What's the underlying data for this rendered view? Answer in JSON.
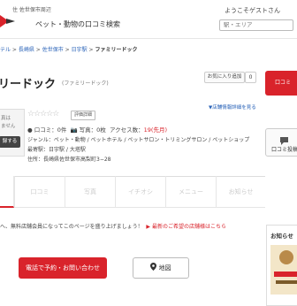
{
  "header": {
    "region": "住 佐世保市周辺",
    "site_name": "ペット・動物の口コミ検索",
    "welcome": "ようこそゲストさん",
    "search_placeholder": "駅・エリア"
  },
  "breadcrumb": {
    "items": [
      "テル",
      "長崎県",
      "佐世保市",
      "日宇駅"
    ],
    "separator": " > ",
    "current": "ファミリードック"
  },
  "store": {
    "title": "リードック",
    "reading": "(ファミリードック)",
    "favorite_label": "お気に入り追加",
    "favorite_count": "0",
    "info_link": "▼店舗情報詳細を見る",
    "photo_text": "真は\nません",
    "register_label": "録する",
    "stars": "☆☆☆☆☆",
    "rating_label": "評価詳細",
    "stats": {
      "reviews": "● 口コミ：0件",
      "photos": "📷 写真：0枚",
      "access_prefix": "アクセス数：",
      "access_value": "19(先月)"
    },
    "genre": "ジャンル：ペット・動物 / ペットホテル / ペットサロン・トリミングサロン / ペットショップ",
    "station": "最寄駅：日宇駅 / 大塔駅",
    "address": "住所：長崎県佐世保市高梨町3−28"
  },
  "side": {
    "red_label": "口コミ",
    "review_label": "口コミ投稿"
  },
  "tabs": [
    "口コミ",
    "写真",
    "イチオシ",
    "メニュー",
    "お知らせ"
  ],
  "notice": {
    "text": "へ、無料店舗会員になってこのページを盛り上げましょう！",
    "link": "▶ 最新のご希望の店舗様はこちら"
  },
  "actions": {
    "contact": "電話で予約・お問い合わせ",
    "map": "地図"
  },
  "sidebar": {
    "title": "お知らせ"
  },
  "colors": {
    "accent": "#d9232b",
    "link": "#2a63b8"
  }
}
